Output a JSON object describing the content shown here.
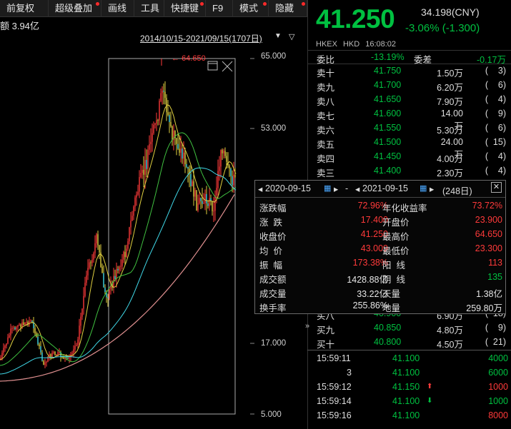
{
  "toolbar": [
    {
      "name": "tb-fuquan",
      "label": "前复权",
      "dot": false,
      "w": 68
    },
    {
      "name": "tb-overlay",
      "label": "超级叠加",
      "dot": true,
      "w": 74
    },
    {
      "name": "tb-draw",
      "label": "画线",
      "dot": false,
      "w": 46
    },
    {
      "name": "tb-tools",
      "label": "工具",
      "dot": false,
      "w": 42
    },
    {
      "name": "tb-shortcut",
      "label": "快捷键",
      "dot": true,
      "w": 58
    },
    {
      "name": "tb-f9",
      "label": "F9",
      "dot": false,
      "w": 38
    },
    {
      "name": "tb-mode",
      "label": "模式",
      "dot": true,
      "w": 50
    },
    {
      "name": "tb-hide",
      "label": "隐藏",
      "dot": true,
      "w": 54
    }
  ],
  "chart": {
    "volume_label": "额 3.94亿",
    "date_range": "2014/10/15-2021/09/15(1707日)",
    "max_label": "64.650",
    "y_ticks": [
      "65.000",
      "53.000",
      "17.000",
      "5.000"
    ]
  },
  "quote": {
    "last_price": "41.250",
    "ref_price": "34.198(CNY)",
    "change": "-3.06% (-1.300)",
    "market": [
      "HKEX",
      "HKD",
      "16:08:02"
    ],
    "ratio": {
      "label1": "委比",
      "value1": "-13.19%",
      "label2": "委差",
      "value2": "-0.17万"
    },
    "asks": [
      {
        "label": "卖十",
        "price": "41.750",
        "vol": "1.50万",
        "cnt": "(    3)"
      },
      {
        "label": "卖九",
        "price": "41.700",
        "vol": "6.20万",
        "cnt": "(    6)"
      },
      {
        "label": "卖八",
        "price": "41.650",
        "vol": "7.90万",
        "cnt": "(    4)"
      },
      {
        "label": "卖七",
        "price": "41.600",
        "vol": "14.00万",
        "cnt": "(    9)"
      },
      {
        "label": "卖六",
        "price": "41.550",
        "vol": "5.30万",
        "cnt": "(    6)"
      },
      {
        "label": "卖五",
        "price": "41.500",
        "vol": "24.00万",
        "cnt": "(  15)"
      },
      {
        "label": "卖四",
        "price": "41.450",
        "vol": "4.00万",
        "cnt": "(    4)"
      },
      {
        "label": "卖三",
        "price": "41.400",
        "vol": "2.30万",
        "cnt": "(    4)"
      }
    ],
    "bids": [
      {
        "label": "买八",
        "price": "40.900",
        "vol": "6.90万",
        "cnt": "(  18)"
      },
      {
        "label": "买九",
        "price": "40.850",
        "vol": "4.80万",
        "cnt": "(    9)"
      },
      {
        "label": "买十",
        "price": "40.800",
        "vol": "4.50万",
        "cnt": "(  21)"
      }
    ],
    "trades": [
      {
        "time": "15:59:11",
        "price": "41.100",
        "arrow": "",
        "vol": "4000",
        "vcolor": "green"
      },
      {
        "time": "3",
        "price": "41.100",
        "arrow": "",
        "vol": "6000",
        "vcolor": "green"
      },
      {
        "time": "15:59:12",
        "price": "41.150",
        "arrow": "up",
        "vol": "1000",
        "vcolor": "red"
      },
      {
        "time": "15:59:14",
        "price": "41.100",
        "arrow": "down",
        "vol": "1000",
        "vcolor": "green"
      },
      {
        "time": "15:59:16",
        "price": "41.100",
        "arrow": "",
        "vol": "8000",
        "vcolor": "red"
      }
    ]
  },
  "popup": {
    "start_date": "2020-09-15",
    "end_date": "2021-09-15",
    "dash": "-",
    "days": "(248日)",
    "rows": [
      {
        "l1": "涨跌幅",
        "v1": "72.96%",
        "c1": "red",
        "l2": "年化收益率",
        "v2": "73.72%",
        "c2": "red"
      },
      {
        "l1": "涨  跌",
        "v1": "17.400",
        "c1": "red",
        "l2": "开盘价",
        "v2": "23.900",
        "c2": "red"
      },
      {
        "l1": "收盘价",
        "v1": "41.250",
        "c1": "red",
        "l2": "最高价",
        "v2": "64.650",
        "c2": "red"
      },
      {
        "l1": "均  价",
        "v1": "43.009",
        "c1": "red",
        "l2": "最低价",
        "v2": "23.300",
        "c2": "red"
      },
      {
        "l1": "振  幅",
        "v1": "173.38%",
        "c1": "red",
        "l2": "阳  线",
        "v2": "113",
        "c2": "red"
      },
      {
        "l1": "成交额",
        "v1": "1428.88亿",
        "c1": "white",
        "l2": "阴  线",
        "v2": "135",
        "c2": "green"
      },
      {
        "l1": "成交量",
        "v1": "33.22亿",
        "c1": "white",
        "l2": "天量",
        "v2": "1.38亿",
        "c2": "white"
      },
      {
        "l1": "换手率",
        "v1": "255.86%",
        "c1": "white",
        "l2": "地量",
        "v2": "259.80万",
        "c2": "white"
      }
    ]
  },
  "colors": {
    "up": "#ff3a3a",
    "down": "#00c040",
    "ma_yellow": "#e0d040",
    "ma_cyan": "#40d8e8",
    "ma_green": "#40c040",
    "ma_pink": "#e09090"
  }
}
